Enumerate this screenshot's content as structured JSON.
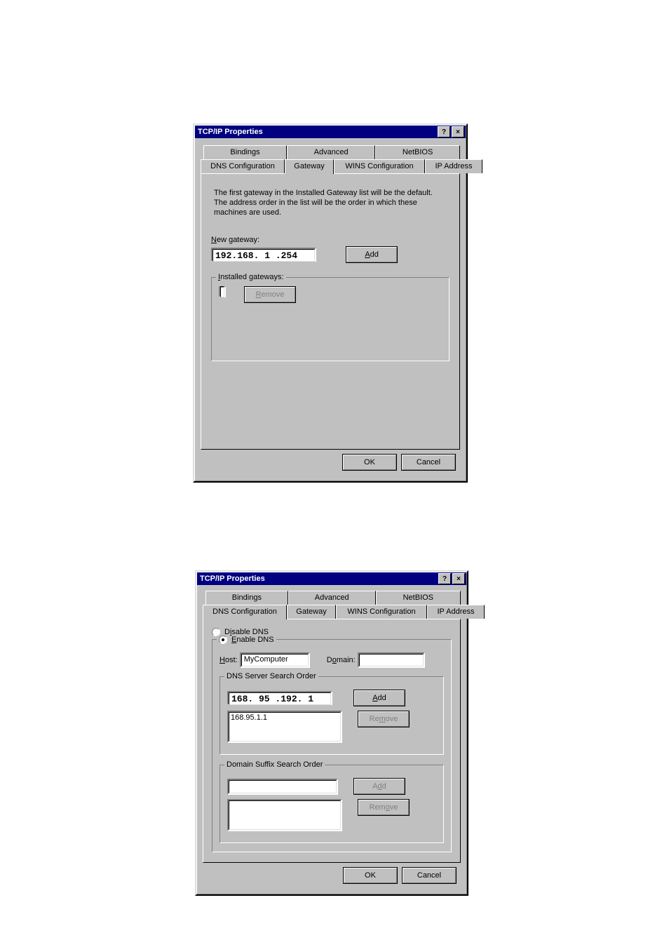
{
  "dialog1": {
    "title": "TCP/IP Properties",
    "help": "?",
    "close": "×",
    "tabs_row1": [
      "Bindings",
      "Advanced",
      "NetBIOS"
    ],
    "tabs_row2": [
      "DNS Configuration",
      "Gateway",
      "WINS Configuration",
      "IP Address"
    ],
    "active_tab": "Gateway",
    "description": "The first gateway in the Installed Gateway list will be the default. The address order in the list will be the order in which these machines are used.",
    "new_gateway_label": "New gateway:",
    "new_gateway_value": "192.168.  1 .254",
    "add_label": "Add",
    "installed_label": "Installed gateways:",
    "remove_label": "Remove",
    "ok": "OK",
    "cancel": "Cancel"
  },
  "dialog2": {
    "title": "TCP/IP Properties",
    "help": "?",
    "close": "×",
    "tabs_row1": [
      "Bindings",
      "Advanced",
      "NetBIOS"
    ],
    "tabs_row2": [
      "DNS Configuration",
      "Gateway",
      "WINS Configuration",
      "IP Address"
    ],
    "active_tab": "DNS Configuration",
    "disable_label": "Disable DNS",
    "enable_label": "Enable DNS",
    "dns_enabled": true,
    "host_label": "Host:",
    "host_value": "MyComputer",
    "domain_label": "Domain:",
    "domain_value": "",
    "dns_order_label": "DNS Server Search Order",
    "dns_input": "168. 95 .192.  1",
    "dns_list": [
      "168.95.1.1"
    ],
    "add_label": "Add",
    "remove_label": "Remove",
    "suffix_label": "Domain Suffix Search Order",
    "suffix_input": "",
    "suffix_list": [],
    "add2_label": "Add",
    "remove2_label": "Remove",
    "ok": "OK",
    "cancel": "Cancel"
  }
}
